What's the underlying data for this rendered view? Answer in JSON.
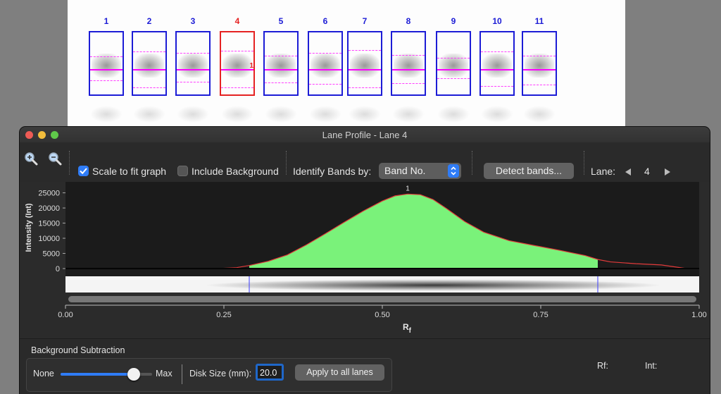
{
  "gel": {
    "lanes": [
      {
        "number": "1",
        "selected": false
      },
      {
        "number": "2",
        "selected": false
      },
      {
        "number": "3",
        "selected": false
      },
      {
        "number": "4",
        "selected": true,
        "band_label": "1"
      },
      {
        "number": "5",
        "selected": false
      },
      {
        "number": "6",
        "selected": false
      },
      {
        "number": "7",
        "selected": false
      },
      {
        "number": "8",
        "selected": false
      },
      {
        "number": "9",
        "selected": false
      },
      {
        "number": "10",
        "selected": false
      },
      {
        "number": "11",
        "selected": false
      }
    ]
  },
  "window": {
    "title": "Lane Profile - Lane 4"
  },
  "toolbar": {
    "zoom_in_icon": "magnifier-plus-icon",
    "zoom_out_icon": "magnifier-minus-icon",
    "scale_to_fit": {
      "label": "Scale to fit graph",
      "checked": true
    },
    "include_background": {
      "label": "Include Background",
      "checked": false
    },
    "identify_label": "Identify Bands by:",
    "identify_value": "Band No.",
    "detect_button": "Detect bands...",
    "lane_label": "Lane:",
    "lane_value": "4"
  },
  "chart_data": {
    "type": "area",
    "ylabel": "Intensity (Int)",
    "xlabel": "Rf",
    "xlim": [
      0,
      1
    ],
    "ylim": [
      0,
      27000
    ],
    "yticks": [
      "0",
      "5000",
      "10000",
      "15000",
      "20000",
      "25000"
    ],
    "xticks": [
      "0.00",
      "0.25",
      "0.50",
      "0.75",
      "1.00"
    ],
    "band_label": "1",
    "band_range": [
      0.29,
      0.84
    ],
    "x": [
      0.24,
      0.27,
      0.29,
      0.32,
      0.35,
      0.38,
      0.41,
      0.44,
      0.47,
      0.5,
      0.52,
      0.54,
      0.56,
      0.58,
      0.6,
      0.63,
      0.66,
      0.7,
      0.74,
      0.78,
      0.82,
      0.84,
      0.86,
      0.9,
      0.94,
      0.98
    ],
    "y": [
      0,
      300,
      1000,
      2400,
      4500,
      7800,
      11500,
      15300,
      19000,
      22300,
      24000,
      24600,
      24400,
      22800,
      20000,
      15500,
      12000,
      9200,
      7600,
      6000,
      4300,
      3000,
      2200,
      1600,
      1200,
      0
    ],
    "colors": {
      "fill": "#7af27a",
      "line": "#e23a3a",
      "marker": "#3c3cff"
    }
  },
  "background_subtraction": {
    "title": "Background Subtraction",
    "min_label": "None",
    "max_label": "Max",
    "slider_value": 0.8,
    "disk_label": "Disk Size (mm):",
    "disk_value": "20.0",
    "apply_button": "Apply to all lanes"
  },
  "readouts": {
    "rf_label": "Rf:",
    "int_label": "Int:"
  }
}
